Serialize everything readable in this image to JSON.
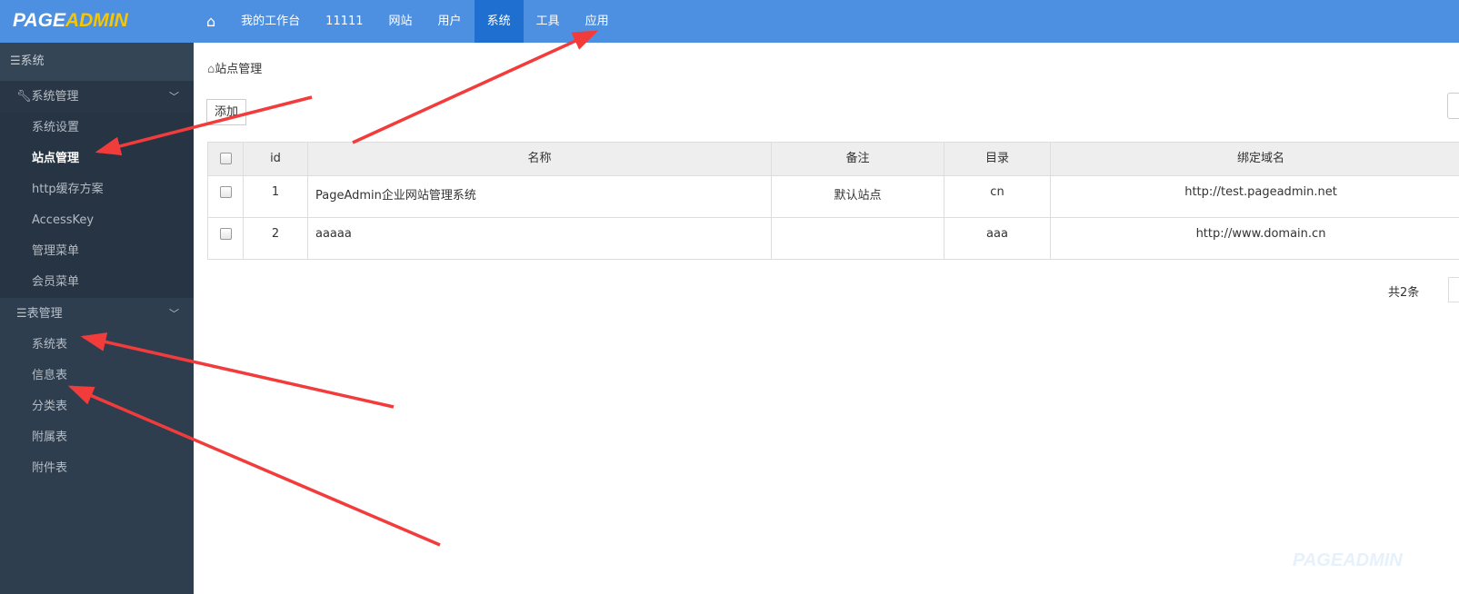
{
  "logo": {
    "part1": "PAGE",
    "part2": "ADMIN"
  },
  "nav": {
    "home_icon": "home-icon",
    "items": [
      "我的工作台",
      "11111",
      "网站",
      "用户",
      "系统",
      "工具",
      "应用"
    ],
    "active": "系统"
  },
  "sidebar": {
    "title": "系统",
    "groups": [
      {
        "label": "系统管理",
        "icon": "wrench-icon",
        "items": [
          "系统设置",
          "站点管理",
          "http缓存方案",
          "AccessKey",
          "管理菜单",
          "会员菜单"
        ],
        "current": "站点管理"
      },
      {
        "label": "表管理",
        "icon": "database-icon",
        "items": [
          "系统表",
          "信息表",
          "分类表",
          "附属表",
          "附件表"
        ]
      }
    ]
  },
  "breadcrumb": "站点管理",
  "toolbar": {
    "add_label": "添加"
  },
  "table": {
    "headers": [
      "id",
      "名称",
      "备注",
      "目录",
      "绑定域名"
    ],
    "rows": [
      {
        "id": "1",
        "name": "PageAdmin企业网站管理系统",
        "note": "默认站点",
        "dir": "cn",
        "domain": "http://test.pageadmin.net"
      },
      {
        "id": "2",
        "name": "aaaaa",
        "note": "",
        "dir": "aaa",
        "domain": "http://www.domain.cn"
      }
    ]
  },
  "pagination": {
    "total": "共2条"
  },
  "watermark": "PAGEADMIN",
  "colors": {
    "topbar": "#4d90e2",
    "active_tab": "#1f6fd0",
    "sidebar": "#2f3e4f",
    "arrow": "#f23c3c",
    "logo_accent": "#f7c600"
  }
}
